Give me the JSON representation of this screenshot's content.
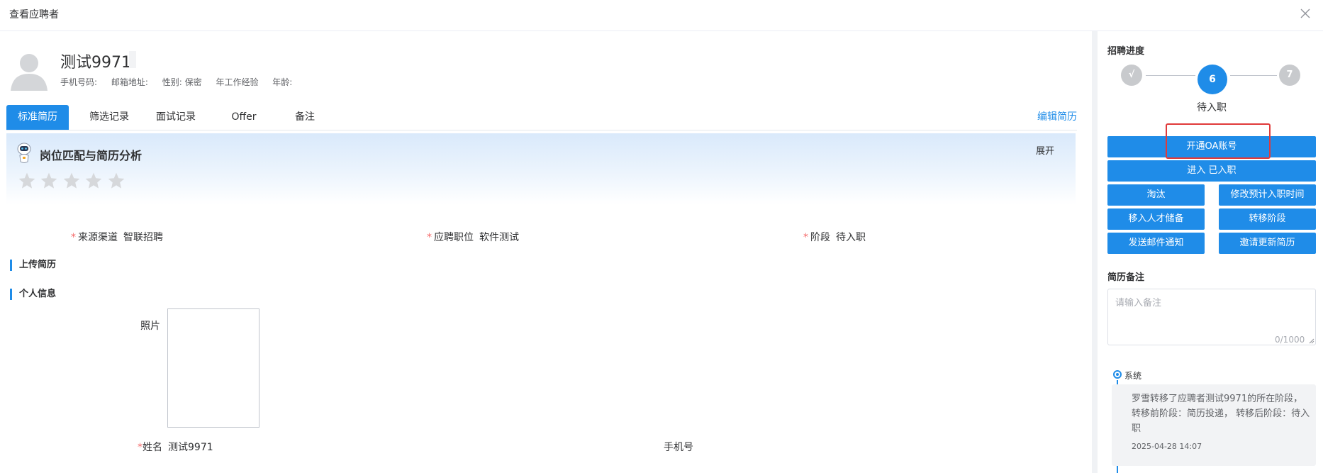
{
  "dialog": {
    "title": "查看应聘者"
  },
  "candidate": {
    "name": "测试9971",
    "meta": [
      "手机号码:",
      "邮箱地址:",
      "性别: 保密",
      "年工作经验",
      "年龄:"
    ]
  },
  "tabs": [
    {
      "label": "标准简历",
      "active": true
    },
    {
      "label": "筛选记录",
      "active": false
    },
    {
      "label": "面试记录",
      "active": false
    },
    {
      "label": "Offer",
      "active": false
    },
    {
      "label": "备注",
      "active": false
    }
  ],
  "edit_resume_label": "编辑简历",
  "ai": {
    "title": "岗位匹配与简历分析",
    "expand_label": "展开",
    "rating": 0,
    "max_rating": 5
  },
  "fields": {
    "source": {
      "label": "来源渠道",
      "value": "智联招聘"
    },
    "position": {
      "label": "应聘职位",
      "value": "软件测试"
    },
    "stage": {
      "label": "阶段",
      "value": "待入职"
    }
  },
  "sections": {
    "upload": "上传简历",
    "personal": "个人信息"
  },
  "personal": {
    "photo_label": "照片",
    "name_label": "姓名",
    "name_value": "测试9971",
    "phone_label": "手机号"
  },
  "progress": {
    "title": "招聘进度",
    "steps": [
      "√",
      "6",
      "7"
    ],
    "current_caption": "待入职"
  },
  "actions": {
    "open_oa": "开通OA账号",
    "enter_onboard": "进入 已入职",
    "eliminate": "淘汰",
    "modify_date": "修改预计入职时间",
    "move_talent": "移入人才储备",
    "transfer_stage": "转移阶段",
    "send_email": "发送邮件通知",
    "invite_update": "邀请更新简历"
  },
  "notes": {
    "title": "简历备注",
    "placeholder": "请输入备注",
    "counter": "0/1000"
  },
  "timeline": [
    {
      "author": "系统",
      "text": "罗雪转移了应聘者测试9971的所在阶段， 转移前阶段：简历投递， 转移后阶段：待入职",
      "time": "2025-04-28 14:07"
    }
  ],
  "colors": {
    "primary": "#1f8ce8",
    "highlight": "#e03a3a",
    "required": "#f56c6c",
    "step_done": "#c8cacd"
  }
}
